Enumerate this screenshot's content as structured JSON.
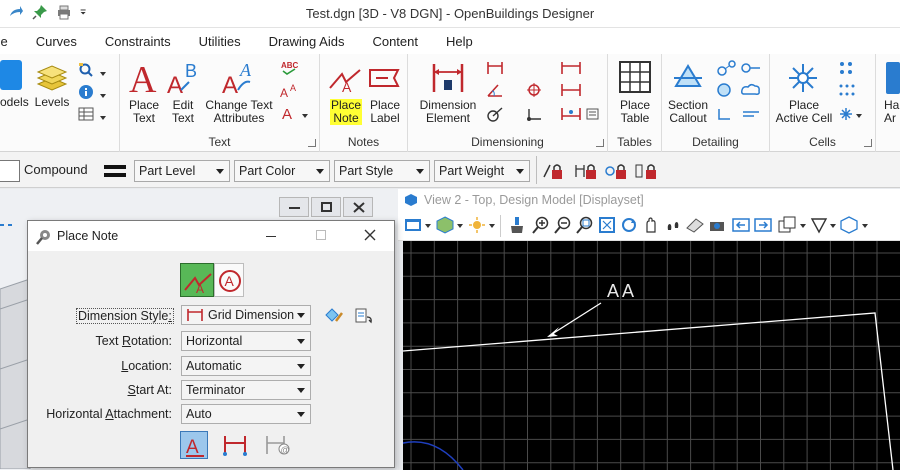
{
  "window": {
    "title": "Test.dgn [3D - V8 DGN] - OpenBuildings Designer"
  },
  "tabs": [
    "ze",
    "Curves",
    "Constraints",
    "Utilities",
    "Drawing Aids",
    "Content",
    "Help"
  ],
  "ribbon": {
    "models_label": "odels",
    "levels_label": "Levels",
    "text_group": {
      "label": "Text",
      "place_text": [
        "Place",
        "Text"
      ],
      "edit_text": [
        "Edit",
        "Text"
      ],
      "change_text": [
        "Change Text",
        "Attributes"
      ]
    },
    "notes_group": {
      "label": "Notes",
      "place_note": [
        "Place",
        "Note"
      ],
      "place_label": [
        "Place",
        "Label"
      ]
    },
    "dimensioning_group": {
      "label": "Dimensioning",
      "dimension_element": [
        "Dimension",
        "Element"
      ]
    },
    "tables_group": {
      "label": "Tables",
      "place_table": [
        "Place",
        "Table"
      ]
    },
    "detailing_group": {
      "label": "Detailing",
      "section_callout": [
        "Section",
        "Callout"
      ]
    },
    "cells_group": {
      "label": "Cells",
      "place_active_cell": [
        "Place",
        "Active Cell"
      ]
    },
    "cut_label": [
      "Ha",
      "Ar"
    ]
  },
  "attributes": {
    "compound": "Compound",
    "level": "Part Level",
    "color": "Part Color",
    "style": "Part Style",
    "weight": "Part Weight"
  },
  "view2": {
    "title": "View 2 - Top, Design Model [Displayset]",
    "note_text": "AA"
  },
  "dialog": {
    "title": "Place Note",
    "rows": [
      {
        "label_pre": "Dimension Style",
        "label_u": ":",
        "label_post": "",
        "value": "Grid Dimension"
      },
      {
        "label_pre": "Text ",
        "label_u": "R",
        "label_post": "otation:",
        "value": "Horizontal"
      },
      {
        "label_pre": "",
        "label_u": "L",
        "label_post": "ocation:",
        "value": "Automatic"
      },
      {
        "label_pre": "",
        "label_u": "S",
        "label_post": "tart At:",
        "value": "Terminator"
      },
      {
        "label_pre": "Horizontal ",
        "label_u": "A",
        "label_post": "ttachment:",
        "value": "Auto"
      }
    ]
  },
  "colors": {
    "accent_red": "#c0282d",
    "highlight": "#ffff33",
    "blue_icon": "#2a7ccf"
  }
}
